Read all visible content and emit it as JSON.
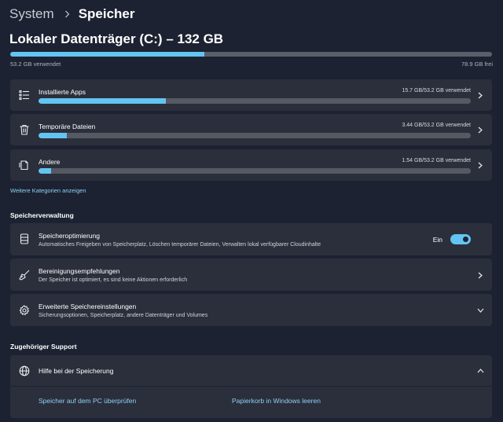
{
  "breadcrumb": {
    "parent": "System",
    "current": "Speicher"
  },
  "drive": {
    "title": "Lokaler Datenträger (C:) – 132 GB",
    "used_label": "53.2 GB verwendet",
    "free_label": "78.9 GB frei",
    "used_fraction": 0.403
  },
  "categories": [
    {
      "label": "Installierte Apps",
      "usage": "15.7 GB/53.2 GB verwendet",
      "fraction": 0.295,
      "icon": "apps-list-icon"
    },
    {
      "label": "Temporäre Dateien",
      "usage": "3.44 GB/53.2 GB verwendet",
      "fraction": 0.065,
      "icon": "trash-icon"
    },
    {
      "label": "Andere",
      "usage": "1.54 GB/53.2 GB verwendet",
      "fraction": 0.029,
      "icon": "other-files-icon"
    }
  ],
  "more_categories_link": "Weitere Kategorien anzeigen",
  "management": {
    "title": "Speicherverwaltung",
    "items": [
      {
        "title": "Speicheroptimierung",
        "subtitle": "Automatisches Freigeben von Speicherplatz, Löschen temporärer Dateien, Verwalten lokal verfügbarer Cloudinhalte",
        "toggle_label": "Ein",
        "toggle_on": true,
        "icon": "storage-sense-icon"
      },
      {
        "title": "Bereinigungsempfehlungen",
        "subtitle": "Der Speicher ist optimiert, es sind keine Aktionen erforderlich",
        "icon": "broom-icon"
      },
      {
        "title": "Erweiterte Speichereinstellungen",
        "subtitle": "Sicherungsoptionen, Speicherplatz, andere Datenträger und Volumes",
        "icon": "gear-icon"
      }
    ]
  },
  "support": {
    "title": "Zugehöriger Support",
    "help_title": "Hilfe bei der Speicherung",
    "links": [
      "Speicher auf dem PC überprüfen",
      "Papierkorb in Windows leeren"
    ]
  },
  "colors": {
    "background": "#1c2231",
    "card": "#2a2f3b",
    "accent": "#63c4f2",
    "link": "#8fd0f4"
  }
}
